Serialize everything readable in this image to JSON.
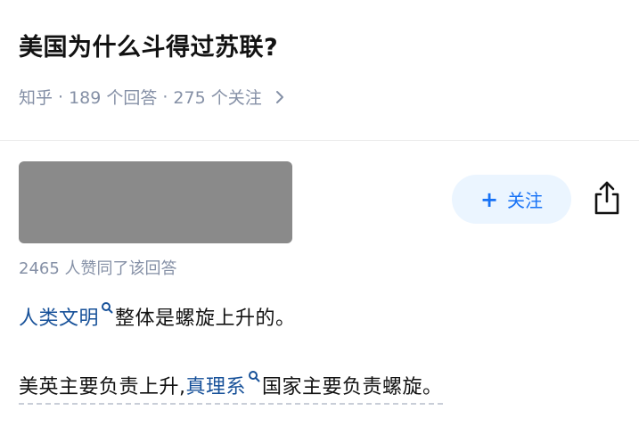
{
  "question": {
    "title": "美国为什么斗得过苏联?",
    "source": "知乎",
    "separator": "·",
    "answers_count": "189 个回答",
    "followers_count": "275 个关注"
  },
  "answer": {
    "follow_label": "关注",
    "vote_text": "2465 人赞同了该回答",
    "line1": {
      "link_text": "人类文明",
      "rest_text": "整体是螺旋上升的。"
    },
    "line2": {
      "before_text": "美英主要负责上升,",
      "link_text": "真理系",
      "after_text": "国家主要负责螺旋。"
    }
  },
  "colors": {
    "link": "#175199",
    "accent_blue": "#1772f6",
    "follow_bg": "#ebf5ff",
    "meta_gray": "#8590a6"
  },
  "icons": [
    "chevron-right-icon",
    "plus-icon",
    "share-icon",
    "search-sup-icon"
  ]
}
